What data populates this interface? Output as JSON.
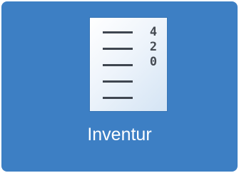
{
  "tile": {
    "label": "Inventur",
    "icon": "inventory-document-icon",
    "icon_digits": [
      "4",
      "2",
      "0"
    ],
    "background_color": "#3d7fc4"
  }
}
